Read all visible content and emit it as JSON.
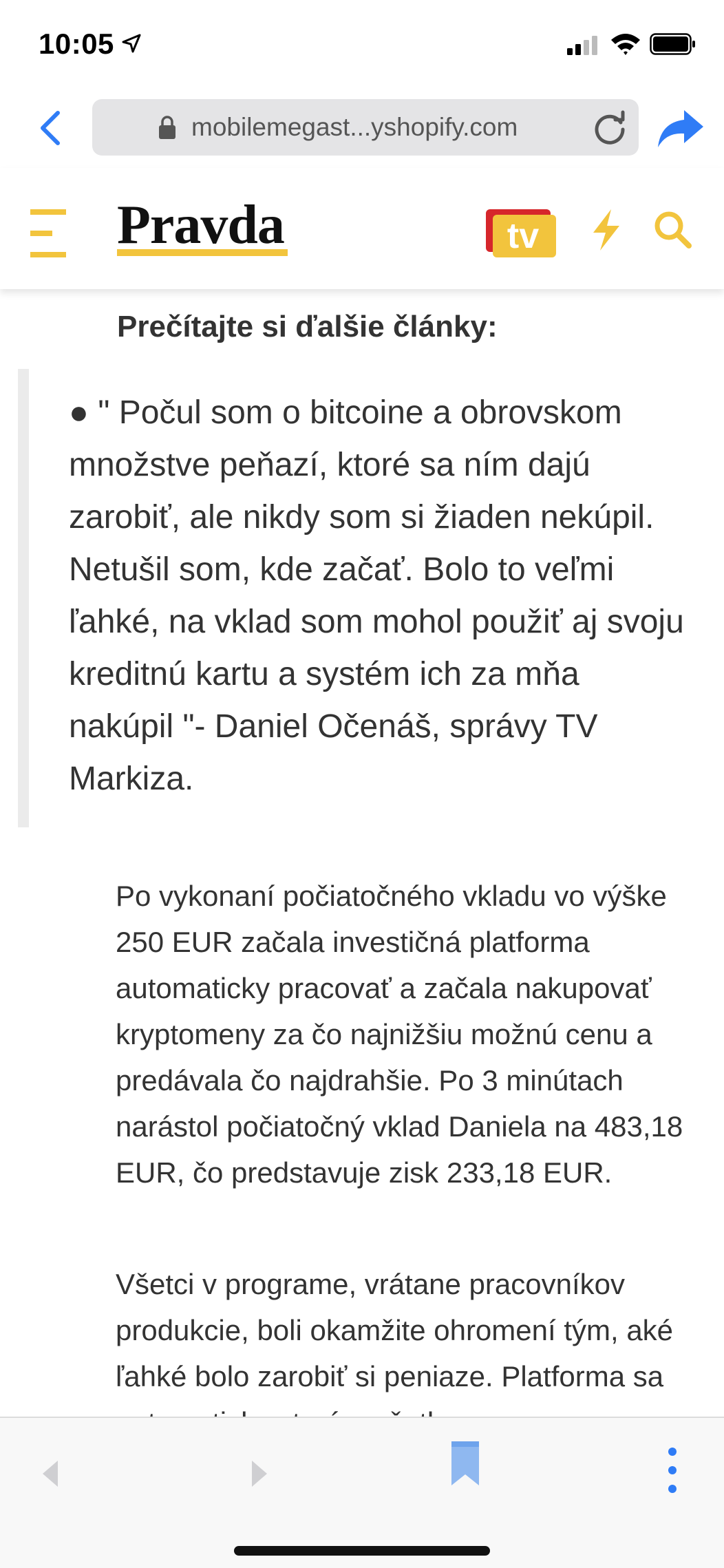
{
  "status_bar": {
    "time": "10:05"
  },
  "browser": {
    "url": "mobilemegast...yshopify.com"
  },
  "site": {
    "logo": "Pravda",
    "brand_color": "#f2c43d"
  },
  "article": {
    "section_heading": "Prečítajte si ďalšie články:",
    "quote": "● \" Počul som o bitcoine a obrovskom množstve peňazí, ktoré sa ním dajú zarobiť, ale nikdy som si žiaden nekúpil. Netušil som, kde začať. Bolo to veľmi ľahké, na vklad som mohol použiť aj svoju kreditnú kartu a systém ich za mňa nakúpil \"- Daniel Očenáš, správy TV Markiza.",
    "paragraph_1": "Po vykonaní počiatočného vkladu vo výške 250 EUR začala investičná platforma automaticky pracovať a začala nakupovať kryptomeny za čo najnižšiu možnú cenu a predávala čo najdrahšie. Po 3 minútach narástol počiatočný vklad Daniela na 483,18 EUR, čo predstavuje zisk 233,18 EUR.",
    "paragraph_2": "Všetci v programe, vrátane pracovníkov produkcie, boli okamžite ohromení tým, aké ľahké bolo zarobiť si peniaze. Platforma sa automaticky stará o všetky"
  },
  "icons": {
    "location": "location-arrow-icon",
    "signal": "cellular-signal-icon",
    "wifi": "wifi-icon",
    "battery": "battery-icon",
    "back": "chevron-left-icon",
    "lock": "lock-icon",
    "reload": "reload-icon",
    "share": "share-icon",
    "menu": "hamburger-menu-icon",
    "tv": "tv-icon",
    "bolt": "lightning-bolt-icon",
    "search": "search-icon",
    "bookmark": "bookmark-icon",
    "more": "more-vertical-icon"
  },
  "colors": {
    "accent_blue": "#2f7cf6",
    "brand_yellow": "#f2c43d",
    "tv_red": "#d6262b"
  }
}
